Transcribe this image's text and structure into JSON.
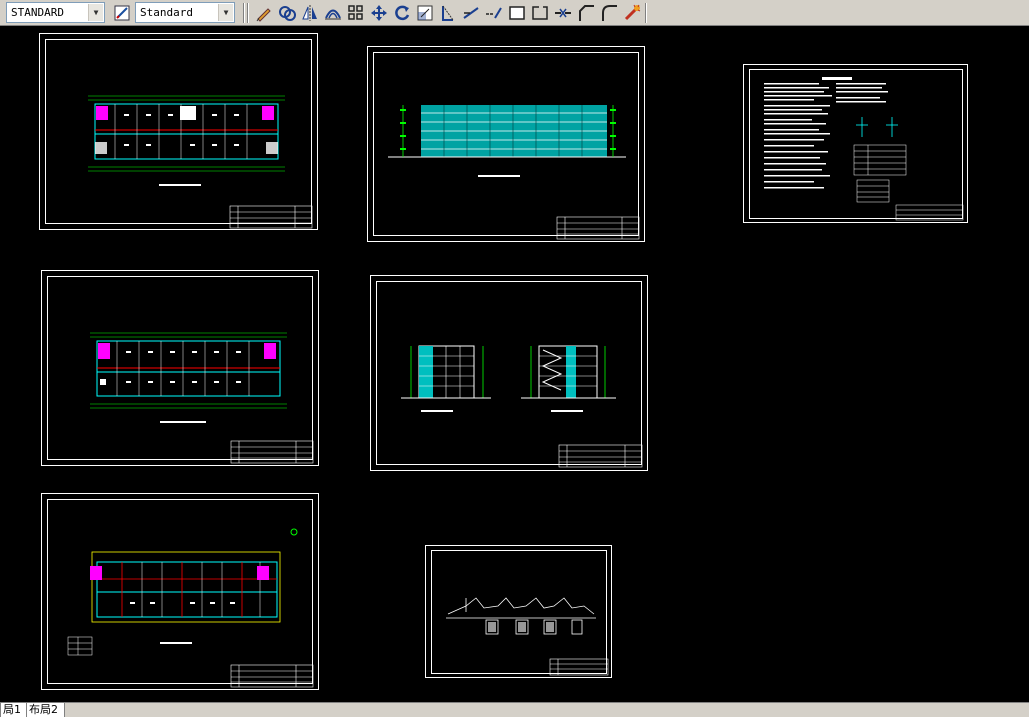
{
  "toolbar": {
    "text_style_value": "STANDARD",
    "dim_style_value": "Standard",
    "icons": [
      "pencil-icon",
      "copy-icon",
      "mirror-icon",
      "offset-icon",
      "array-icon",
      "move-icon",
      "rotate-icon",
      "scale-icon",
      "stretch-icon",
      "trim-icon",
      "extend-icon",
      "break-icon",
      "break-at-point-icon",
      "join-icon",
      "chamfer-icon",
      "fillet-icon",
      "explode-icon"
    ]
  },
  "canvas": {
    "background": "#000000",
    "sheets": [
      {
        "name": "first-floor-plan-sheet"
      },
      {
        "name": "south-elevation-sheet"
      },
      {
        "name": "design-notes-sheet"
      },
      {
        "name": "standard-floor-plan-sheet"
      },
      {
        "name": "sections-sheet"
      },
      {
        "name": "top-floor-plan-sheet"
      },
      {
        "name": "details-sheet"
      }
    ]
  },
  "tabs": {
    "layout1": "局1",
    "layout2": "布局2"
  },
  "colors": {
    "cyan": "#00ffff",
    "magenta": "#ff00ff",
    "red": "#ff0000",
    "green": "#00ff00",
    "yellow": "#ffff00",
    "white": "#ffffff"
  }
}
